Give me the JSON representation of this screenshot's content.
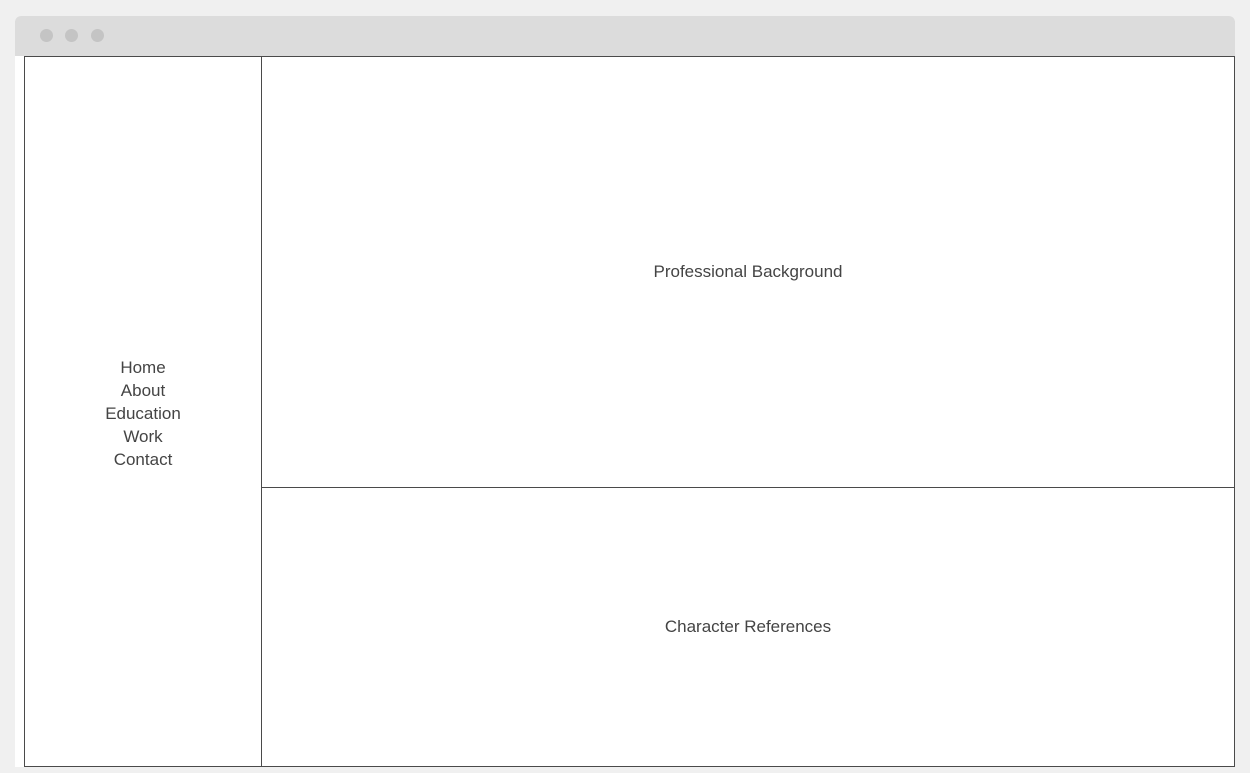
{
  "nav": {
    "items": [
      {
        "label": "Home"
      },
      {
        "label": "About"
      },
      {
        "label": "Education"
      },
      {
        "label": "Work"
      },
      {
        "label": "Contact"
      }
    ]
  },
  "sections": {
    "professional_background": "Professional Background",
    "character_references": "Character References"
  }
}
